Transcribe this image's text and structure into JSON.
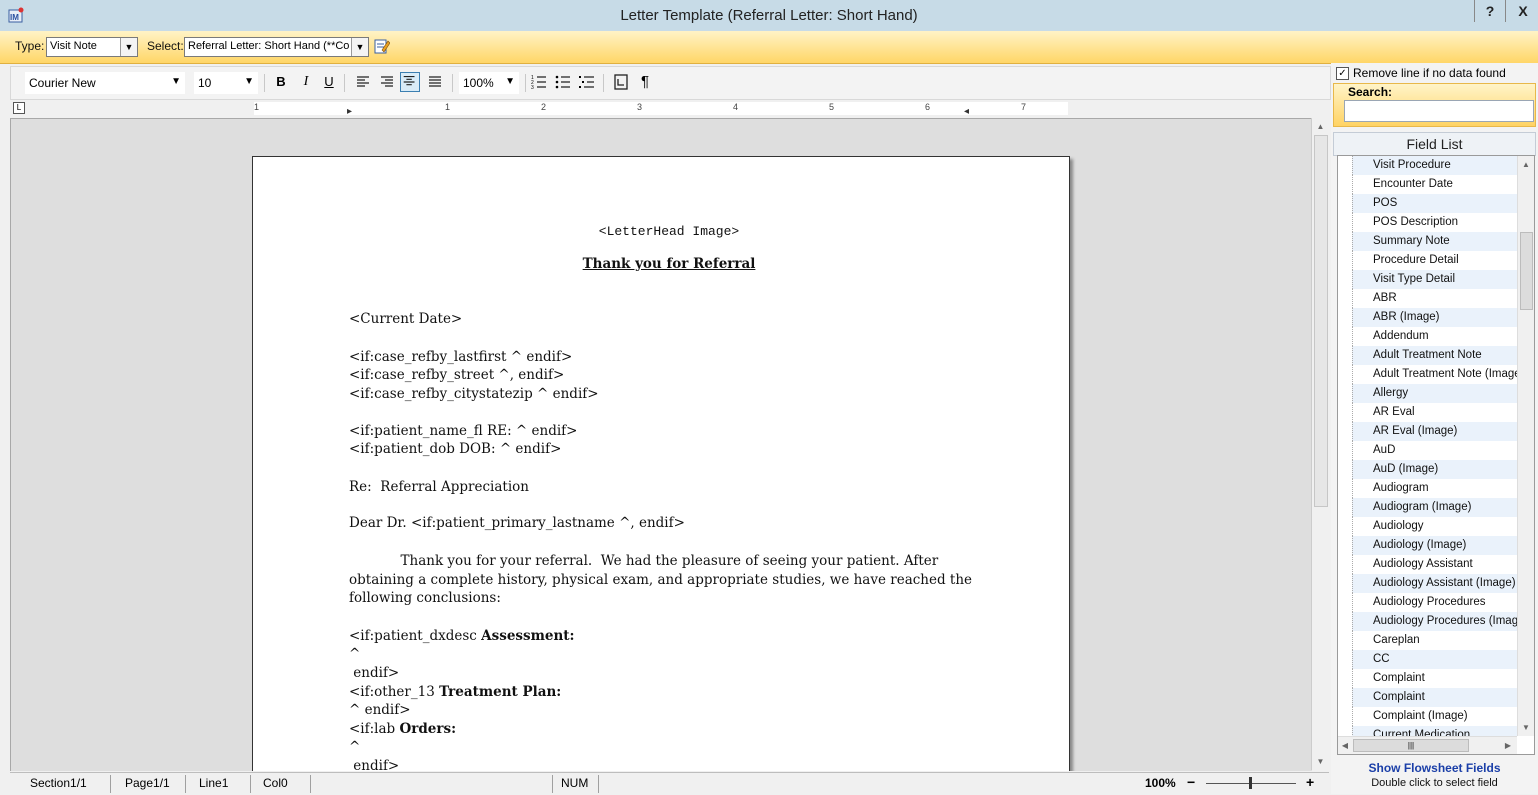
{
  "window": {
    "title": "Letter Template (Referral Letter: Short Hand)",
    "help": "?",
    "close": "X"
  },
  "typebar": {
    "type_label": "Type:",
    "type_value": "Visit Note",
    "select_label": "Select:",
    "select_value": "Referral Letter: Short Hand  (**Con"
  },
  "toolbar": {
    "font": "Courier New",
    "size": "10",
    "bold": "B",
    "italic": "I",
    "underline": "U",
    "zoom": "100%",
    "pilcrow": "¶"
  },
  "ruler": {
    "numbers": [
      "1",
      "1",
      "2",
      "3",
      "4",
      "5",
      "6",
      "7"
    ]
  },
  "document": {
    "letterhead": "<LetterHead Image>",
    "heading": "Thank you for Referral",
    "current_date": "<Current Date>",
    "addr1": "<if:case_refby_lastfirst ^ endif>",
    "addr2": "<if:case_refby_street ^, endif>",
    "addr3": "<if:case_refby_citystatezip ^ endif>",
    "pat1": "<if:patient_name_fl RE: ^ endif>",
    "pat2": "<if:patient_dob DOB: ^ endif>",
    "re_line": "Re:  Referral Appreciation",
    "dear": "Dear Dr. <if:patient_primary_lastname ^, endif>",
    "body": "            Thank you for your referral.  We had the pleasure of seeing your patient. After obtaining a complete history, physical exam, and appropriate studies, we have reached the following conclusions:",
    "assess_prefix": "<if:patient_dxdesc ",
    "assess_bold": "Assessment:",
    "caret1": "^",
    "endif1": " endif>",
    "treat_prefix": "<if:other_13 ",
    "treat_bold": "Treatment Plan:",
    "treat_end": "^ endif>",
    "lab_prefix": "<if:lab ",
    "lab_bold": "Orders:",
    "caret2": "^",
    "endif2": " endif>"
  },
  "statusbar": {
    "section": "Section1/1",
    "page": "Page1/1",
    "line": "Line1",
    "col": "Col0",
    "num": "NUM",
    "zoom": "100%",
    "minus": "−",
    "plus": "+"
  },
  "panel": {
    "remove_line": "Remove line if no data found",
    "search_label": "Search:",
    "field_list_title": "Field List",
    "fields": [
      "Visit Procedure",
      "Encounter Date",
      "POS",
      "POS Description",
      "Summary Note",
      "Procedure Detail",
      "Visit Type Detail",
      "ABR",
      "ABR (Image)",
      "Addendum",
      "Adult Treatment Note",
      "Adult Treatment Note (Image)",
      "Allergy",
      "AR Eval",
      "AR Eval (Image)",
      "AuD",
      "AuD (Image)",
      "Audiogram",
      "Audiogram (Image)",
      "Audiology",
      "Audiology (Image)",
      "Audiology Assistant",
      "Audiology Assistant (Image)",
      "Audiology Procedures",
      "Audiology Procedures (Image)",
      "Careplan",
      "CC",
      "Complaint",
      "Complaint",
      "Complaint (Image)",
      "Current Medication"
    ],
    "show_flowsheet": "Show Flowsheet Fields",
    "hint": "Double click to select field"
  },
  "colors": {
    "accent_bar": "#ffd667",
    "title_bar": "#c7dbe7",
    "link": "#1b3fa8"
  }
}
